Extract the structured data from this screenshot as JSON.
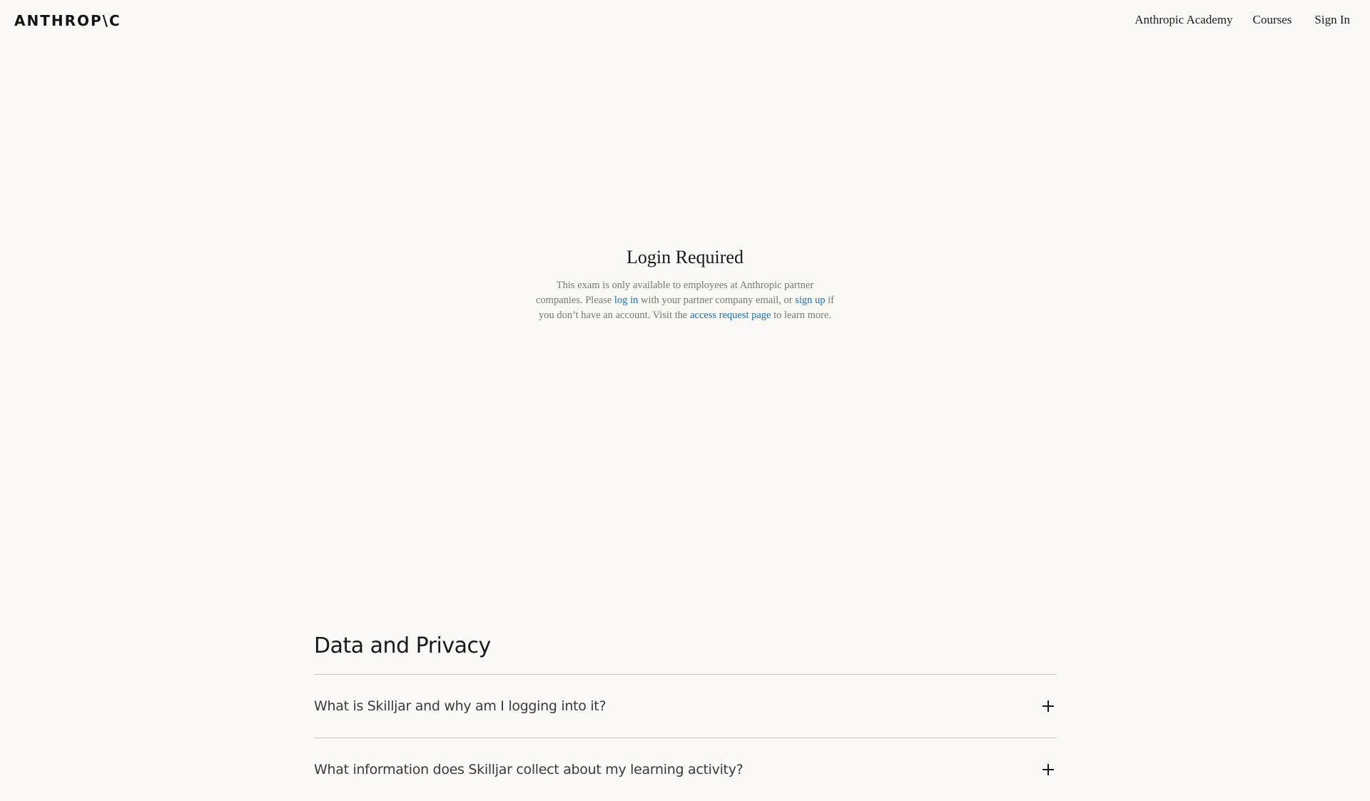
{
  "header": {
    "logo_text": "ANTHROP\\C",
    "nav": {
      "academy": "Anthropic Academy",
      "courses": "Courses",
      "sign_in": "Sign In"
    }
  },
  "login": {
    "title": "Login Required",
    "text_1": "This exam is only available to employees at Anthropic partner companies. Please ",
    "link_log_in": "log in",
    "text_2": " with your partner company email, or ",
    "link_sign_up": "sign up",
    "text_3": " if you don’t have an account. Visit the ",
    "link_access_request": "access request page",
    "text_4": " to learn more."
  },
  "privacy": {
    "title": "Data and Privacy",
    "faq": [
      {
        "question": "What is Skilljar and why am I logging into it?"
      },
      {
        "question": "What information does Skilljar collect about my learning activity?"
      }
    ]
  },
  "colors": {
    "background": "#faf9f5",
    "link": "#1a6fb0",
    "muted_text": "#777770"
  }
}
